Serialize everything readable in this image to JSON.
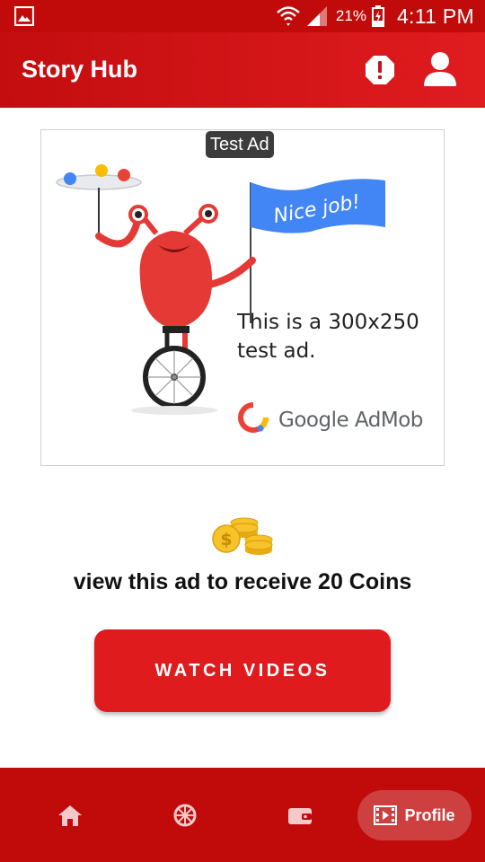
{
  "status_bar": {
    "battery_percent": "21%",
    "time": "4:11 PM"
  },
  "app_bar": {
    "title": "Story Hub"
  },
  "ad": {
    "badge": "Test Ad",
    "flag_text": "Nice job!",
    "body_text": "This is a 300x250 test ad.",
    "brand": "Google AdMob"
  },
  "reward": {
    "message": "view this ad to receive 20 Coins"
  },
  "cta": {
    "label": "WATCH VIDEOS"
  },
  "bottom_nav": {
    "items": [
      {
        "icon": "home-icon"
      },
      {
        "icon": "spin-wheel-icon"
      },
      {
        "icon": "wallet-icon"
      },
      {
        "icon": "film-icon",
        "label": "Profile",
        "selected": true
      }
    ]
  },
  "colors": {
    "brand_red": "#c10b0b",
    "button_red": "#df1b1e"
  }
}
